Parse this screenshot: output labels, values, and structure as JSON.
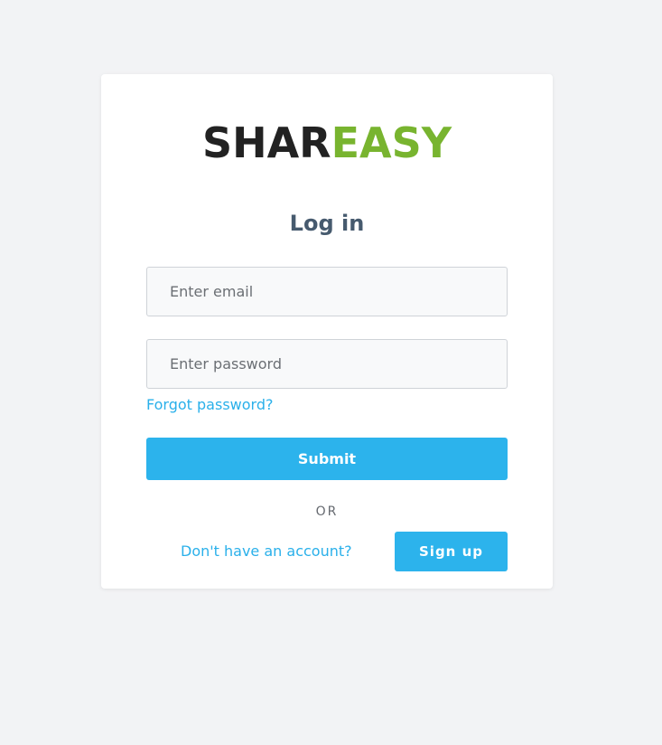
{
  "logo": {
    "part1": "SHAR",
    "part2": "EASY",
    "colors": {
      "part1": "#222222",
      "part2": "#78b42f"
    }
  },
  "title": "Log in",
  "form": {
    "email_placeholder": "Enter email",
    "email_value": "",
    "password_placeholder": "Enter password",
    "password_value": "",
    "forgot_label": "Forgot password?",
    "submit_label": "Submit"
  },
  "divider_label": "OR",
  "signup": {
    "prompt": "Don't have an account?",
    "button_label": "Sign up"
  },
  "colors": {
    "accent": "#2cb3ec",
    "heading": "#465a6e",
    "background": "#f2f3f5"
  }
}
